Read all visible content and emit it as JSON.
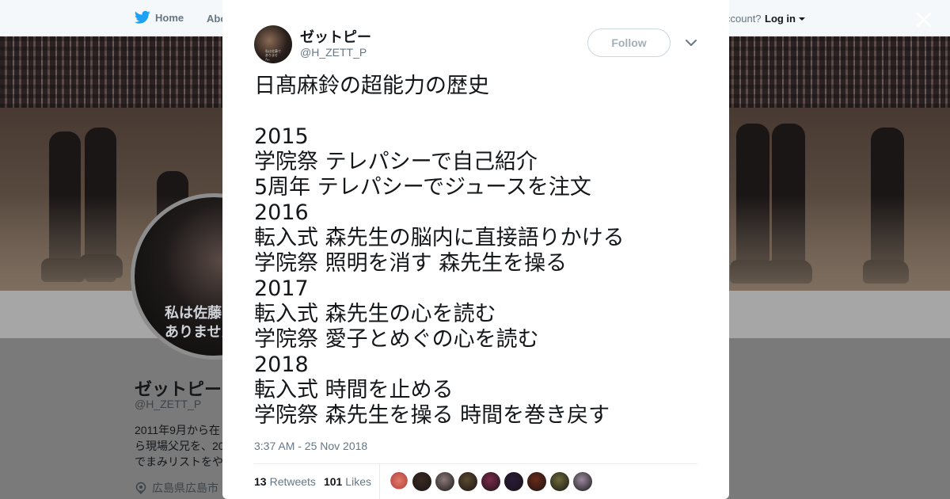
{
  "nav": {
    "home_label": "Home",
    "about_label": "Abo",
    "account_text": "ccount?",
    "login_label": "Log in"
  },
  "profile": {
    "name": "ゼットピー",
    "handle": "@H_ZETT_P",
    "bio_lines": [
      "2011年9月から在",
      "ら現場父兄を、20",
      "でまみリストをや"
    ],
    "location": "広島県広島市",
    "avatar_caption_lines": [
      "私は佐藤で",
      "ありません。"
    ]
  },
  "tweet": {
    "author_name": "ゼットピー",
    "author_handle": "@H_ZETT_P",
    "follow_label": "Follow",
    "lines": [
      "日髙麻鈴の超能力の歴史",
      "",
      "2015",
      "学院祭 テレパシーで自己紹介",
      "5周年 テレパシーでジュースを注文",
      "2016",
      "転入式 森先生の脳内に直接語りかける",
      "学院祭 照明を消す 森先生を操る",
      "2017",
      "転入式 森先生の心を読む",
      "学院祭 愛子とめぐの心を読む",
      "2018",
      "転入式 時間を止める",
      "学院祭 森先生を操る 時間を巻き戻す"
    ],
    "timestamp": "3:37 AM - 25 Nov 2018",
    "retweets_count": "13",
    "retweets_label": "Retweets",
    "likes_count": "101",
    "likes_label": "Likes",
    "liker_colors": [
      "#d96a5a",
      "#3a2a22",
      "#8a7a7a",
      "#5a4a30",
      "#7a2a4a",
      "#2a1a3a",
      "#6a2a1a",
      "#6a6a3a",
      "#9a8aa0"
    ]
  },
  "icons": {
    "twitter_bird": "twitter-bird-icon",
    "close": "close-icon",
    "caret": "caret-down-icon",
    "chevron": "chevron-down-icon",
    "location": "location-pin-icon"
  }
}
